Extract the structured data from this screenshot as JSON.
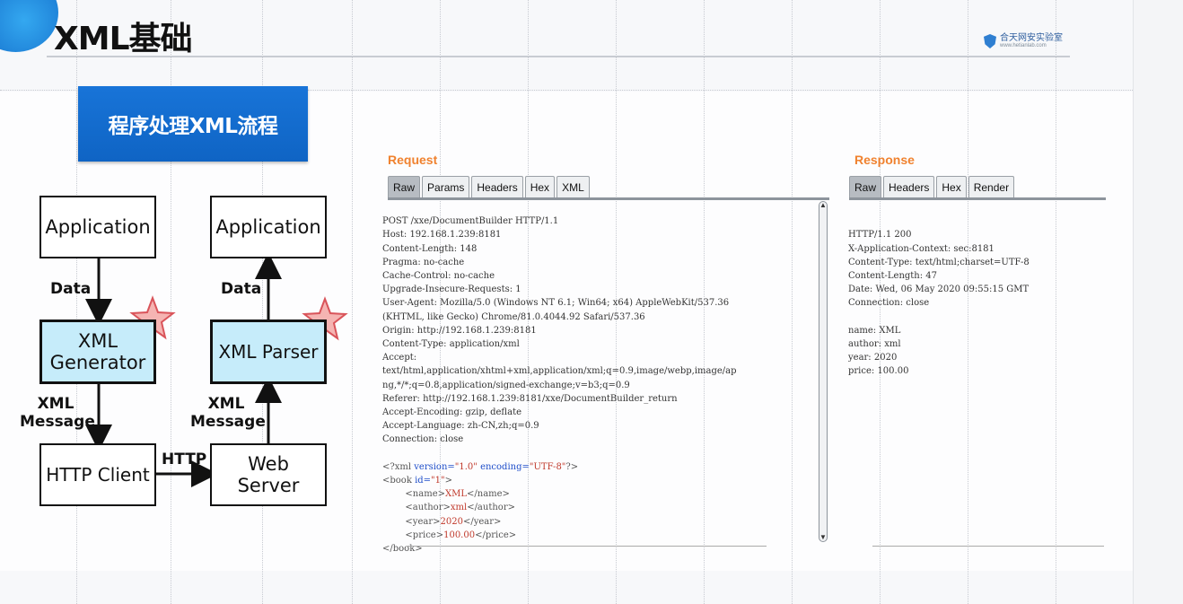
{
  "slide": {
    "title": "XML基础",
    "banner": "程序处理XML流程",
    "logo_text": "合天网安实验室",
    "logo_sub": "www.hetianlab.com"
  },
  "diagram": {
    "left_app": "Application",
    "right_app": "Application",
    "left_data": "Data",
    "right_data": "Data",
    "xml_generator": "XML Generator",
    "xml_parser": "XML Parser",
    "left_msg": "XML Message",
    "right_msg": "XML Message",
    "http_client": "HTTP Client",
    "web_server": "Web Server",
    "http": "HTTP"
  },
  "request": {
    "title": "Request",
    "tabs": [
      "Raw",
      "Params",
      "Headers",
      "Hex",
      "XML"
    ],
    "lines": [
      "POST /xxe/DocumentBuilder HTTP/1.1",
      "Host: 192.168.1.239:8181",
      "Content-Length: 148",
      "Pragma: no-cache",
      "Cache-Control: no-cache",
      "Upgrade-Insecure-Requests: 1",
      "User-Agent: Mozilla/5.0 (Windows NT 6.1; Win64; x64) AppleWebKit/537.36",
      "(KHTML, like Gecko) Chrome/81.0.4044.92 Safari/537.36",
      "Origin: http://192.168.1.239:8181",
      "Content-Type: application/xml",
      "Accept:",
      "text/html,application/xhtml+xml,application/xml;q=0.9,image/webp,image/ap",
      "ng,*/*;q=0.8,application/signed-exchange;v=b3;q=0.9",
      "Referer: http://192.168.1.239:8181/xxe/DocumentBuilder_return",
      "Accept-Encoding: gzip, deflate",
      "Accept-Language: zh-CN,zh;q=0.9",
      "Connection: close",
      ""
    ],
    "xml": {
      "decl_open": "<?xml ",
      "decl_attr1": "version=",
      "decl_val1": "\"1.0\"",
      "decl_attr2": " encoding=",
      "decl_val2": "\"UTF-8\"",
      "decl_close": "?>",
      "book_open": "<book ",
      "book_attr": "id=",
      "book_val": "\"1\"",
      "book_close": ">",
      "name_open": "        <name>",
      "name_val": "XML",
      "name_close": "</name>",
      "author_open": "        <author>",
      "author_val": "xml",
      "author_close": "</author>",
      "year_open": "        <year>",
      "year_val": "2020",
      "year_close": "</year>",
      "price_open": "        <price>",
      "price_val": "100.00",
      "price_close": "</price>",
      "book_end": "</book>"
    }
  },
  "response": {
    "title": "Response",
    "tabs": [
      "Raw",
      "Headers",
      "Hex",
      "Render"
    ],
    "lines": [
      "HTTP/1.1 200",
      "X-Application-Context: sec:8181",
      "Content-Type: text/html;charset=UTF-8",
      "Content-Length: 47",
      "Date: Wed, 06 May 2020 09:55:15 GMT",
      "Connection: close",
      "",
      "name: XML",
      "author: xml",
      "year: 2020",
      "price: 100.00"
    ]
  }
}
